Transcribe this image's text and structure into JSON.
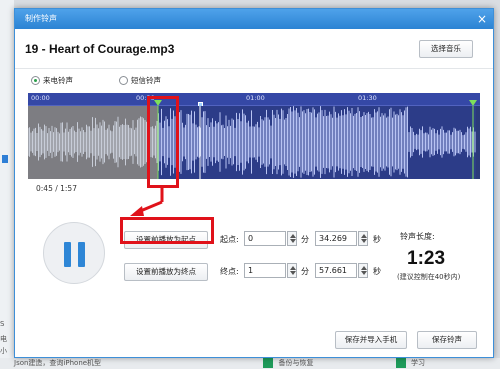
{
  "dialog": {
    "title": "制作铃声",
    "file_name": "19 - Heart of Courage.mp3",
    "choose_music": "选择音乐"
  },
  "ring_type": {
    "options": [
      {
        "label": "来电铃声",
        "selected": true
      },
      {
        "label": "短信铃声",
        "selected": false
      }
    ]
  },
  "waveform": {
    "ruler_labels": [
      "00:00",
      "00:30",
      "01:00",
      "01:30"
    ],
    "colors": {
      "background": "#2a3a7a",
      "wave": "#c9d3ff",
      "selected_region_tint": "#8a8a8a",
      "start_marker": "#7fe05a"
    }
  },
  "playback": {
    "position": "0:45 / 1:57",
    "state": "playing",
    "icon": "pause-icon"
  },
  "start": {
    "button_label": "设置前播放为起点",
    "label": "起点:",
    "minutes": "0",
    "min_unit": "分",
    "seconds": "34.269",
    "sec_unit": "秒"
  },
  "end": {
    "button_label": "设置前播放为终点",
    "label": "终点:",
    "minutes": "1",
    "min_unit": "分",
    "seconds": "57.661",
    "sec_unit": "秒"
  },
  "ringtone": {
    "length_label": "铃声长度:",
    "length_value": "1:23",
    "hint": "(建议控制在40秒内)"
  },
  "footer": {
    "save_import": "保存并导入手机",
    "save_ring": "保存铃声"
  },
  "background": {
    "left_fragments": [
      "S",
      "电",
      "小",
      "SI"
    ],
    "bottom_text_1": "Json​建造，查询iPhone机型",
    "bottom_text_2": "备份与恢复",
    "bottom_text_3": "学习"
  },
  "accent_color": "#2e86d6",
  "annotation_color": "#e0121a"
}
